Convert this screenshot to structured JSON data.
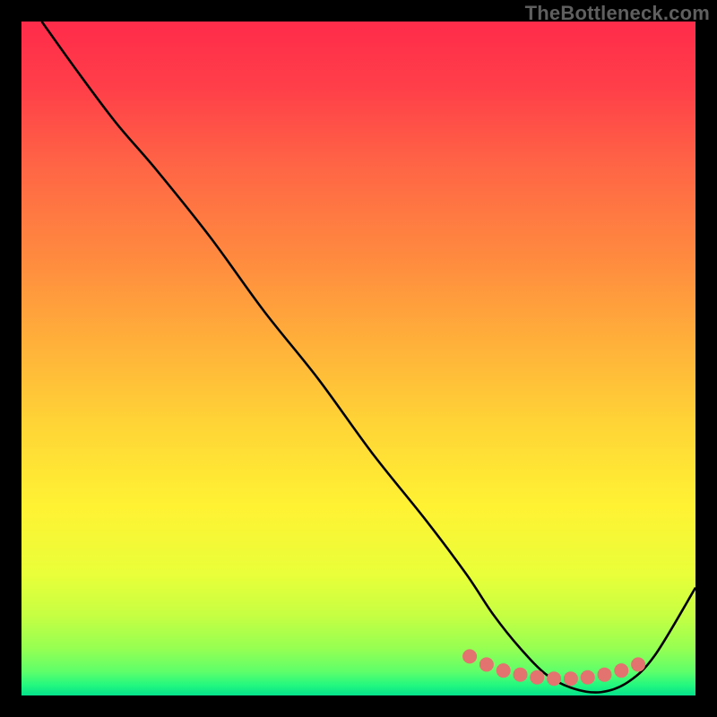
{
  "watermark": "TheBottleneck.com",
  "chart_data": {
    "type": "line",
    "title": "",
    "xlabel": "",
    "ylabel": "",
    "xlim": [
      0,
      100
    ],
    "ylim": [
      0,
      100
    ],
    "series": [
      {
        "name": "curve",
        "x": [
          3,
          8,
          14,
          20,
          28,
          36,
          44,
          52,
          60,
          66,
          70,
          74,
          78,
          82,
          86,
          90,
          94,
          100
        ],
        "y": [
          100,
          93,
          85,
          78,
          68,
          57,
          47,
          36,
          26,
          18,
          12,
          7,
          3,
          1,
          0.5,
          2,
          6,
          16
        ]
      },
      {
        "name": "highlight-dots",
        "x": [
          66.5,
          69,
          71.5,
          74,
          76.5,
          79,
          81.5,
          84,
          86.5,
          89,
          91.5
        ],
        "y": [
          5.8,
          4.6,
          3.7,
          3.1,
          2.7,
          2.5,
          2.5,
          2.7,
          3.1,
          3.7,
          4.6
        ]
      }
    ],
    "gradient_stops": [
      {
        "offset": 0.0,
        "color": "#ff2b4a"
      },
      {
        "offset": 0.1,
        "color": "#ff3f49"
      },
      {
        "offset": 0.22,
        "color": "#ff6745"
      },
      {
        "offset": 0.35,
        "color": "#ff8a3f"
      },
      {
        "offset": 0.48,
        "color": "#ffb13a"
      },
      {
        "offset": 0.6,
        "color": "#ffd536"
      },
      {
        "offset": 0.72,
        "color": "#fff233"
      },
      {
        "offset": 0.82,
        "color": "#e9ff39"
      },
      {
        "offset": 0.88,
        "color": "#c7ff42"
      },
      {
        "offset": 0.93,
        "color": "#96ff52"
      },
      {
        "offset": 0.965,
        "color": "#5dff6b"
      },
      {
        "offset": 0.985,
        "color": "#22f77f"
      },
      {
        "offset": 1.0,
        "color": "#05e08a"
      }
    ],
    "curve_color": "#000000",
    "dot_color": "#e2736e",
    "dot_radius_px": 8
  }
}
